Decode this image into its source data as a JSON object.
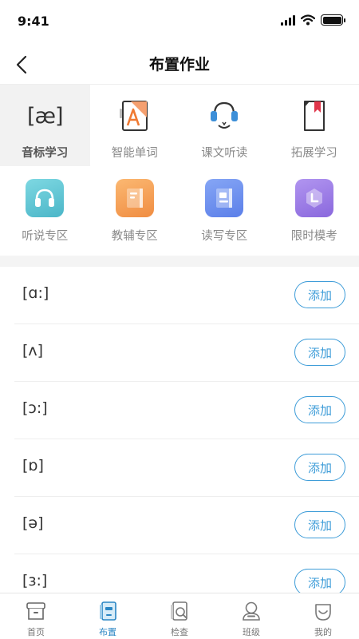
{
  "status_bar": {
    "time": "9:41"
  },
  "nav": {
    "title": "布置作业"
  },
  "categories_row1": [
    {
      "label": "音标学习",
      "icon": "ipa-icon",
      "selected": true
    },
    {
      "label": "智能单词",
      "icon": "word-book-icon"
    },
    {
      "label": "课文听读",
      "icon": "headset-icon"
    },
    {
      "label": "拓展学习",
      "icon": "bookmark-book-icon"
    }
  ],
  "categories_row2": [
    {
      "label": "听说专区",
      "icon": "headphones-icon",
      "color": "#5cc5d3"
    },
    {
      "label": "教辅专区",
      "icon": "textbook-icon",
      "color": "#f5a25a"
    },
    {
      "label": "读写专区",
      "icon": "notebook-icon",
      "color": "#6b8ff0"
    },
    {
      "label": "限时模考",
      "icon": "timer-icon",
      "color": "#9b7be6"
    }
  ],
  "ipa_glyph": "[æ]",
  "phonetics": [
    {
      "symbol": "[ɑ:]",
      "button": "添加"
    },
    {
      "symbol": "[ʌ]",
      "button": "添加"
    },
    {
      "symbol": "[ɔ:]",
      "button": "添加"
    },
    {
      "symbol": "[ɒ]",
      "button": "添加"
    },
    {
      "symbol": "[ə]",
      "button": "添加"
    },
    {
      "symbol": "[ɜ:]",
      "button": "添加"
    }
  ],
  "tab_bar": [
    {
      "label": "首页",
      "icon": "home-icon"
    },
    {
      "label": "布置",
      "icon": "assign-icon",
      "active": true
    },
    {
      "label": "检查",
      "icon": "check-icon"
    },
    {
      "label": "班级",
      "icon": "class-icon"
    },
    {
      "label": "我的",
      "icon": "profile-icon"
    }
  ],
  "colors": {
    "accent": "#3d9cd8",
    "active_tab": "#2a86c4",
    "word_orange": "#f07a32",
    "headset_blue": "#3d8fd8",
    "bookmark_red": "#e0364b"
  }
}
